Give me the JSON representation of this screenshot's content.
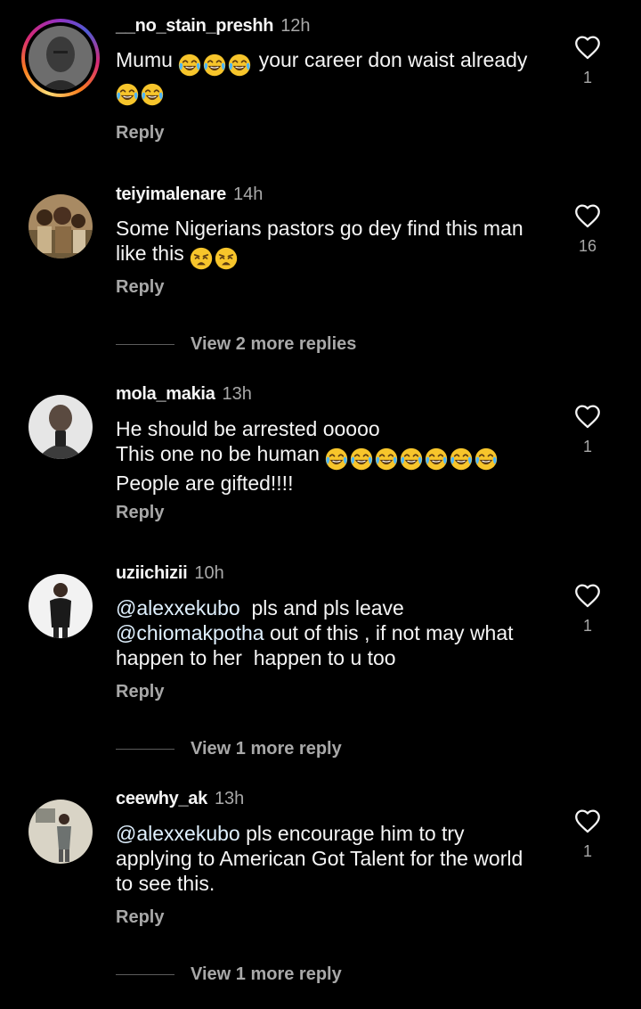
{
  "comments": [
    {
      "username": "__no_stain_preshh",
      "time": "12h",
      "lines": [
        "Mumu",
        "your career don waist already"
      ],
      "likes": "1",
      "reply": "Reply",
      "has_story": true
    },
    {
      "username": "teiyimalenare",
      "time": "14h",
      "lines": [
        "Some Nigerians pastors go dey find this man",
        "like this"
      ],
      "likes": "16",
      "reply": "Reply",
      "more_replies": "View 2 more replies"
    },
    {
      "username": "mola_makia",
      "time": "13h",
      "lines": [
        "He should be arrested ooooo",
        "This one no be human",
        "People are gifted!!!!"
      ],
      "likes": "1",
      "reply": "Reply"
    },
    {
      "username": "uziichizii",
      "time": "10h",
      "mention1": "@alexxekubo",
      "line1_rest": "  pls and pls leave",
      "mention2": "@chiomakpotha",
      "line2_rest": " out of this , if not may what",
      "line3": "happen to her  happen to u too",
      "likes": "1",
      "reply": "Reply",
      "more_replies": "View 1 more reply"
    },
    {
      "username": "ceewhy_ak",
      "time": "13h",
      "mention1": "@alexxekubo",
      "line1_rest": " pls encourage him to try",
      "line2": "applying to American Got Talent for the world",
      "line3": "to see this.",
      "likes": "1",
      "reply": "Reply",
      "more_replies": "View 1 more reply"
    }
  ],
  "icons": {
    "heart": "heart-outline-icon",
    "laugh_emoji": "face-with-tears-of-joy-emoji",
    "weary_emoji": "weary-face-emoji"
  },
  "colors": {
    "background": "#000000",
    "text": "#f5f5f5",
    "secondary": "#a8a8a8",
    "mention": "#e0f1ff",
    "emoji": "#f7c52b"
  }
}
